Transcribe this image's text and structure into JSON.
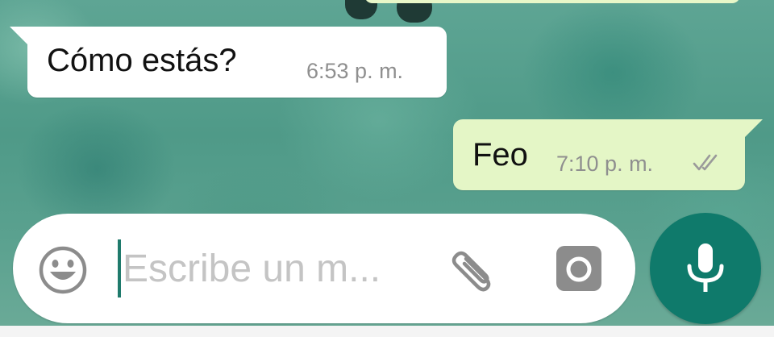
{
  "conversation": {
    "messages": [
      {
        "direction": "incoming",
        "text": "Cómo estás?",
        "time": "6:53 p. m."
      },
      {
        "direction": "outgoing",
        "text": "Feo",
        "time": "7:10 p. m.",
        "status_icon": "double-check-icon"
      }
    ]
  },
  "composer": {
    "placeholder": "Escribe un m...",
    "emoji_icon": "emoji-icon",
    "attach_icon": "paperclip-icon",
    "camera_icon": "camera-icon",
    "mic_icon": "microphone-icon"
  },
  "colors": {
    "outgoing_bubble": "#e4f6c6",
    "incoming_bubble": "#ffffff",
    "accent": "#0f7a6b",
    "timestamp": "#8f8f8f"
  }
}
